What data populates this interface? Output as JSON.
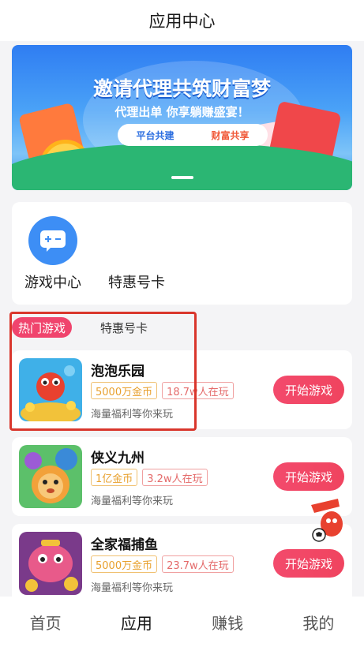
{
  "header": {
    "title": "应用中心"
  },
  "banner": {
    "title": "邀请代理共筑财富梦",
    "subtitle": "代理出单 你享躺赚盛宴！",
    "pill_left": "平台共建",
    "pill_right": "财富共享"
  },
  "apps": [
    {
      "label": "游戏中心",
      "icon": "game-controller-icon"
    },
    {
      "label": "特惠号卡",
      "icon": ""
    }
  ],
  "tabs": {
    "active": "热门游戏",
    "other": "特惠号卡"
  },
  "games": [
    {
      "name": "泡泡乐园",
      "coins": "5000万金币",
      "players": "18.7w人在玩",
      "desc": "海量福利等你来玩",
      "button": "开始游戏"
    },
    {
      "name": "侠义九州",
      "coins": "1亿金币",
      "players": "3.2w人在玩",
      "desc": "海量福利等你来玩",
      "button": "开始游戏"
    },
    {
      "name": "全家福捕鱼",
      "coins": "5000万金币",
      "players": "23.7w人在玩",
      "desc": "海量福利等你来玩",
      "button": "开始游戏"
    }
  ],
  "bottom_nav": [
    {
      "label": "首页"
    },
    {
      "label": "应用",
      "active": true
    },
    {
      "label": "赚钱"
    },
    {
      "label": "我的"
    }
  ],
  "colors": {
    "accent": "#f0446d",
    "highlight_box": "#d9362c",
    "app_icon_blue": "#3d8ef5"
  }
}
